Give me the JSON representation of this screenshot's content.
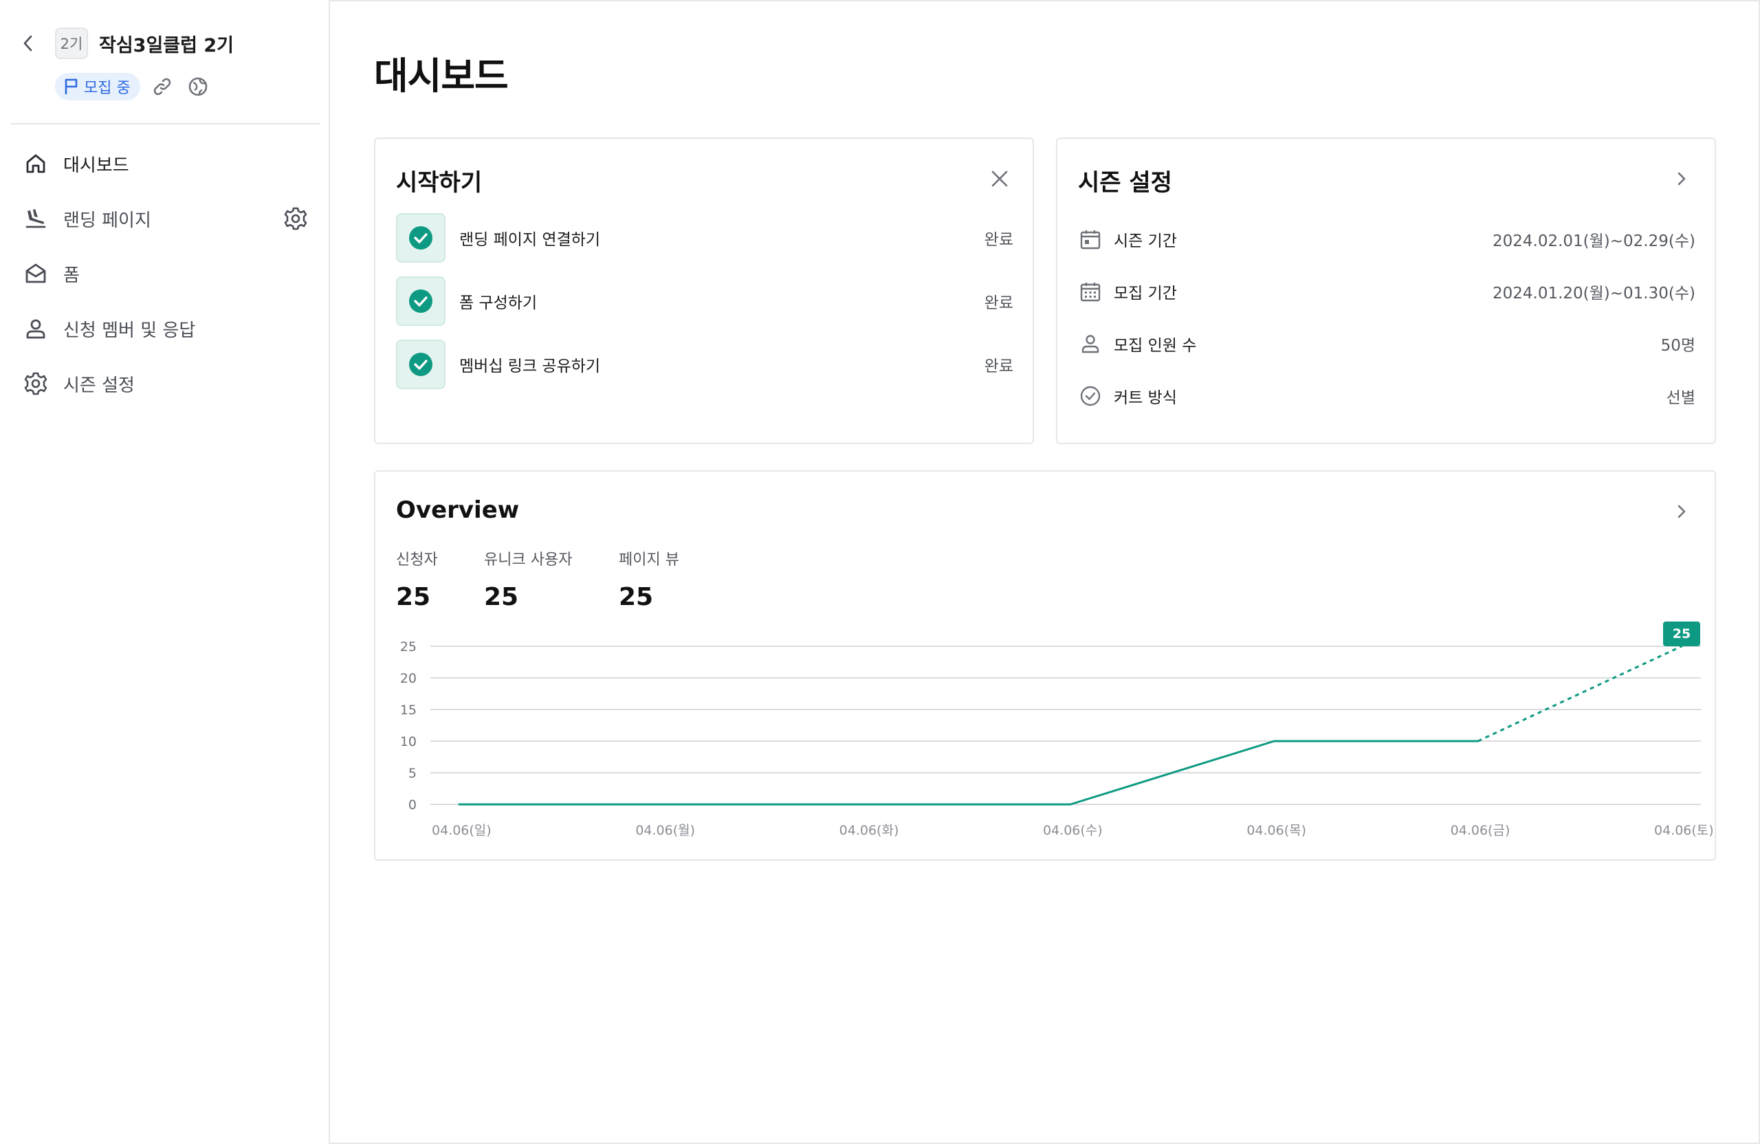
{
  "sidebar": {
    "season_chip": "2기",
    "club_name": "작심3일클럽 2기",
    "status_badge": "모집 중",
    "nav": [
      {
        "label": "대시보드",
        "icon": "home-icon",
        "active": true
      },
      {
        "label": "랜딩 페이지",
        "icon": "landing-icon"
      },
      {
        "label": "폼",
        "icon": "mail-open-icon"
      },
      {
        "label": "신청 멤버 및 응답",
        "icon": "user-icon"
      },
      {
        "label": "시즌 설정",
        "icon": "gear-icon"
      }
    ]
  },
  "main": {
    "title": "대시보드"
  },
  "getting_started": {
    "title": "시작하기",
    "tasks": [
      {
        "label": "랜딩 페이지 연결하기",
        "status": "완료"
      },
      {
        "label": "폼 구성하기",
        "status": "완료"
      },
      {
        "label": "멤버십 링크 공유하기",
        "status": "완료"
      }
    ]
  },
  "season_settings": {
    "title": "시즌 설정",
    "rows": [
      {
        "label": "시즌 기간",
        "value": "2024.02.01(월)~02.29(수)",
        "icon": "calendar-icon"
      },
      {
        "label": "모집 기간",
        "value": "2024.01.20(월)~01.30(수)",
        "icon": "calendar-grid-icon"
      },
      {
        "label": "모집 인원 수",
        "value": "50명",
        "icon": "user-icon"
      },
      {
        "label": "커트 방식",
        "value": "선별",
        "icon": "check-circle-icon"
      }
    ]
  },
  "overview": {
    "title": "Overview",
    "stats": [
      {
        "label": "신청자",
        "value": "25"
      },
      {
        "label": "유니크 사용자",
        "value": "25"
      },
      {
        "label": "페이지 뷰",
        "value": "25"
      }
    ]
  },
  "colors": {
    "accent": "#0e9a82",
    "badge_text": "#2f6ae0",
    "badge_bg": "#e7f0fd",
    "grid": "#d9dbdf"
  },
  "chart_data": {
    "type": "line",
    "categories": [
      "04.06(일)",
      "04.06(월)",
      "04.06(화)",
      "04.06(수)",
      "04.06(목)",
      "04.06(금)",
      "04.06(토)"
    ],
    "series": [
      {
        "values": [
          0,
          0,
          0,
          0,
          10,
          10,
          25
        ]
      }
    ],
    "dashed_last_segment": true,
    "yticks": [
      0,
      5,
      10,
      15,
      20,
      25
    ],
    "ylim": [
      0,
      25
    ],
    "last_value_label": "25",
    "grid": true
  }
}
